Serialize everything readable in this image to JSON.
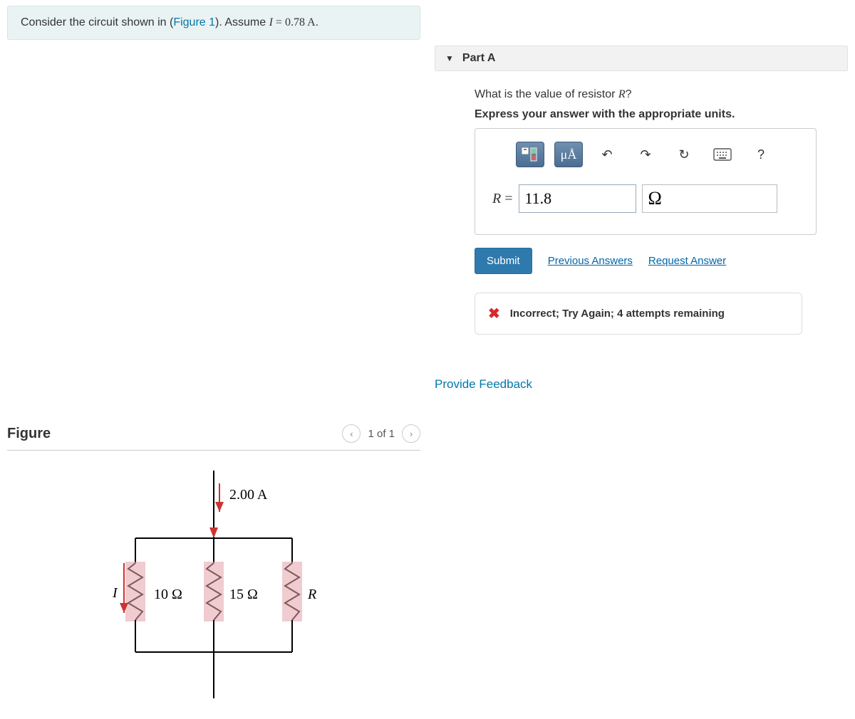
{
  "problem": {
    "prefix": "Consider the circuit shown in (",
    "figure_link": "Figure 1",
    "suffix": "). Assume ",
    "var": "I",
    "eq": " = 0.78 A",
    "tail": "."
  },
  "figure": {
    "title": "Figure",
    "nav_text": "1 of 1",
    "current_label": "2.00 A",
    "i_label": "I",
    "r1_label": "10 Ω",
    "r2_label": "15 Ω",
    "r3_label": "R"
  },
  "part": {
    "title": "Part A",
    "question_prefix": "What is the value of resistor ",
    "question_var": "R",
    "question_suffix": "?",
    "instruction": "Express your answer with the appropriate units."
  },
  "toolbar": {
    "unit_button": "μÅ",
    "help": "?"
  },
  "answer": {
    "var": "R",
    "eq": " = ",
    "value": "11.8",
    "unit": "Ω"
  },
  "actions": {
    "submit": "Submit",
    "previous": "Previous Answers",
    "request": "Request Answer"
  },
  "feedback": {
    "text": "Incorrect; Try Again; 4 attempts remaining"
  },
  "footer": {
    "provide_feedback": "Provide Feedback"
  }
}
